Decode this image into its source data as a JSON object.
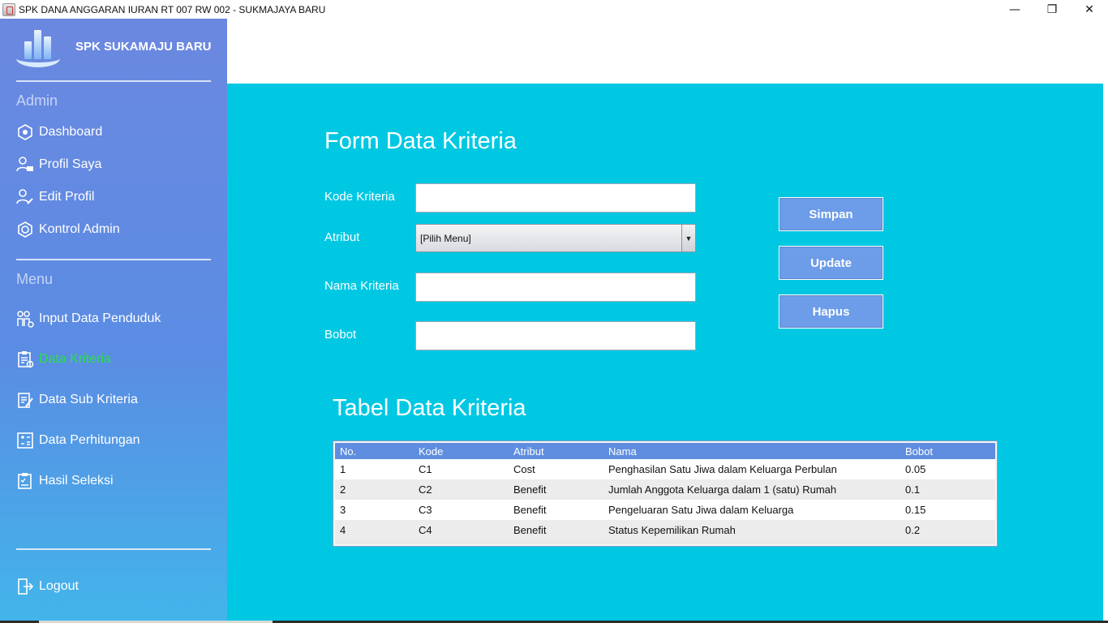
{
  "window": {
    "title": "SPK DANA ANGGARAN IURAN RT 007 RW 002 - SUKMAJAYA BARU",
    "minimize": "—",
    "maximize": "❐",
    "close": "✕"
  },
  "sidebar": {
    "brand": "SPK SUKAMAJU BARU",
    "admin_section": "Admin",
    "admin_items": [
      {
        "label": "Dashboard",
        "icon": "dashboard-icon"
      },
      {
        "label": "Profil Saya",
        "icon": "profile-icon"
      },
      {
        "label": "Edit Profil",
        "icon": "edit-profile-icon"
      },
      {
        "label": "Kontrol Admin",
        "icon": "gear-icon"
      }
    ],
    "menu_section": "Menu",
    "menu_items": [
      {
        "label": "Input Data Penduduk",
        "icon": "people-icon"
      },
      {
        "label": "Data Kriteria",
        "icon": "clipboard-icon",
        "active": true
      },
      {
        "label": "Data Sub Kriteria",
        "icon": "edit-note-icon"
      },
      {
        "label": "Data Perhitungan",
        "icon": "calculator-icon"
      },
      {
        "label": "Hasil Seleksi",
        "icon": "checklist-icon"
      }
    ],
    "logout": "Logout",
    "active_color": "#28e04a"
  },
  "form": {
    "title": "Form Data Kriteria",
    "kode_label": "Kode Kriteria",
    "kode_value": "",
    "atribut_label": "Atribut",
    "atribut_selected": "[Pilih Menu]",
    "nama_label": "Nama Kriteria",
    "nama_value": "",
    "bobot_label": "Bobot",
    "bobot_value": ""
  },
  "buttons": {
    "simpan": "Simpan",
    "update": "Update",
    "hapus": "Hapus"
  },
  "table": {
    "title": "Tabel Data Kriteria",
    "columns": [
      "No.",
      "Kode",
      "Atribut",
      "Nama",
      "Bobot"
    ],
    "rows": [
      [
        "1",
        "C1",
        "Cost",
        "Penghasilan Satu Jiwa dalam Keluarga Perbulan",
        "0.05"
      ],
      [
        "2",
        "C2",
        "Benefit",
        "Jumlah Anggota Keluarga dalam 1 (satu) Rumah",
        "0.1"
      ],
      [
        "3",
        "C3",
        "Benefit",
        "Pengeluaran Satu Jiwa dalam Keluarga",
        "0.15"
      ],
      [
        "4",
        "C4",
        "Benefit",
        "Status Kepemilikan Rumah",
        "0.2"
      ]
    ]
  },
  "colors": {
    "main_bg": "#00c8e3",
    "header_row": "#5f8ee0",
    "button": "#6d9ce8"
  }
}
